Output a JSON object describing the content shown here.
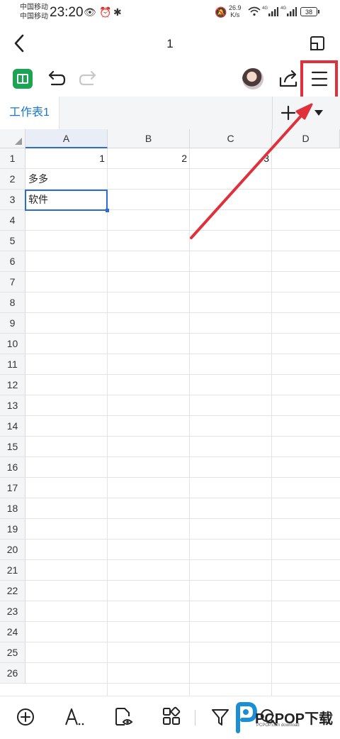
{
  "status_bar": {
    "carrier_1": "中国移动",
    "carrier_2": "中国移动",
    "time": "23:20",
    "net_speed_value": "26.9",
    "net_speed_unit": "K/s",
    "signal_1": "4G",
    "signal_2": "4G",
    "battery": "38"
  },
  "title_bar": {
    "title": "1"
  },
  "sheet_tabs": {
    "active": "工作表1"
  },
  "columns": [
    "A",
    "B",
    "C",
    "D"
  ],
  "rows": [
    "1",
    "2",
    "3",
    "4",
    "5",
    "6",
    "7",
    "8",
    "9",
    "10",
    "11",
    "12",
    "13",
    "14",
    "15",
    "16",
    "17",
    "18",
    "19",
    "20",
    "21",
    "22",
    "23",
    "24",
    "25",
    "26"
  ],
  "cells": {
    "A1": "1",
    "B1": "2",
    "C1": "3",
    "A2": "多多",
    "A3": "软件"
  },
  "selected_cell": "A3",
  "selected_column": "A",
  "annotation": {
    "color": "#e0303b"
  },
  "watermark": {
    "brand": "PCPOP下载",
    "sub": "PCPOP.com download"
  },
  "icons": {
    "back": "back-arrow-icon",
    "fold": "fold-window-icon",
    "undo": "undo-icon",
    "redo": "redo-icon",
    "share": "share-icon",
    "menu": "hamburger-menu-icon",
    "add_sheet": "plus-icon",
    "sheet_menu": "dropdown-triangle-icon",
    "bottom": [
      "insert-icon",
      "text-format-icon",
      "view-icon",
      "apps-icon",
      "filter-icon",
      "search-icon"
    ]
  }
}
